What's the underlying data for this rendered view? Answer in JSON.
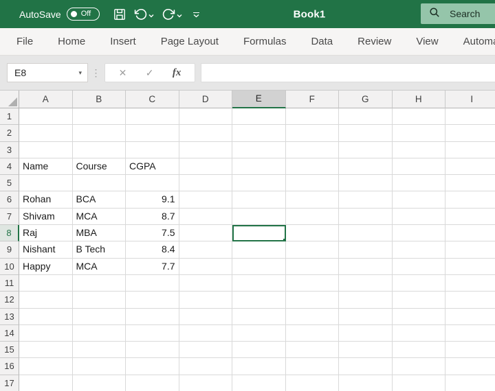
{
  "window": {
    "title": "Book1"
  },
  "titlebar": {
    "autosave_label": "AutoSave",
    "autosave_state": "Off",
    "search_placeholder": "Search"
  },
  "ribbon": {
    "tabs": [
      "File",
      "Home",
      "Insert",
      "Page Layout",
      "Formulas",
      "Data",
      "Review",
      "View",
      "Automate"
    ]
  },
  "formula_bar": {
    "name_box_value": "E8",
    "dropdown_glyph": "▾",
    "separator_glyph": "⋮",
    "cancel_glyph": "✕",
    "enter_glyph": "✓",
    "insert_function_label": "fx",
    "formula_value": ""
  },
  "grid": {
    "columns": [
      "A",
      "B",
      "C",
      "D",
      "E",
      "F",
      "G",
      "H",
      "I"
    ],
    "row_count": 17,
    "selection": {
      "column": "E",
      "row": 8,
      "cell_ref": "E8"
    },
    "cells": {
      "A4": "Name",
      "B4": "Course",
      "C4": "CGPA",
      "A6": "Rohan",
      "B6": "BCA",
      "C6": "9.1",
      "A7": "Shivam",
      "B7": "MCA",
      "C7": "8.7",
      "A8": "Raj",
      "B8": "MBA",
      "C8": "7.5",
      "A9": "Nishant",
      "B9": "B Tech",
      "C9": "8.4",
      "A10": "Happy",
      "B10": "MCA",
      "C10": "7.7"
    }
  },
  "colors": {
    "titlebar_green": "#217346",
    "accent_green": "#217346",
    "search_bg": "#95c5aa",
    "selected_column_header_bg": "#d2d2d2",
    "grid_line": "#d9d9d9"
  }
}
